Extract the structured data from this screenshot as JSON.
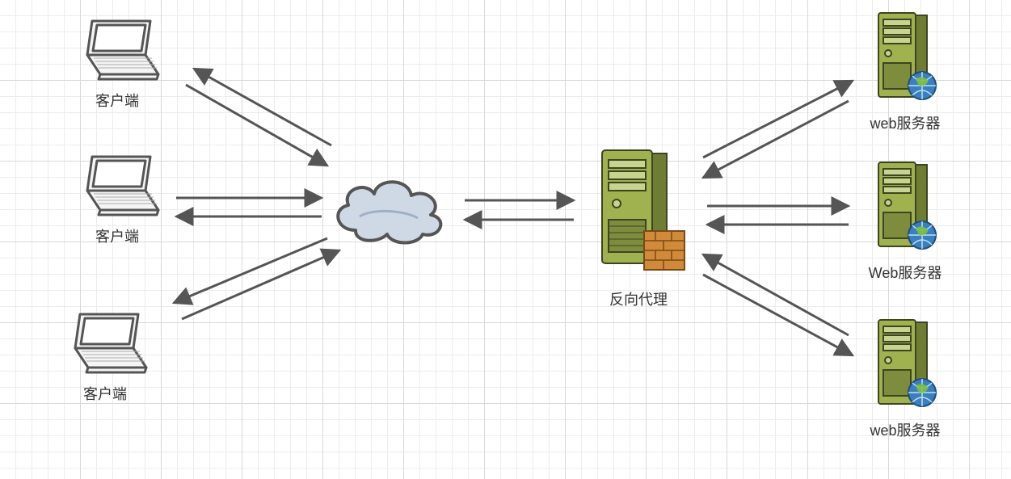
{
  "nodes": {
    "client1": {
      "label": "客户端",
      "icon": "laptop-icon"
    },
    "client2": {
      "label": "客户端",
      "icon": "laptop-icon"
    },
    "client3": {
      "label": "客户端",
      "icon": "laptop-icon"
    },
    "cloud": {
      "label": "",
      "icon": "cloud-icon"
    },
    "proxy": {
      "label": "反向代理",
      "icon": "server-firewall-icon"
    },
    "web1": {
      "label": "web服务器",
      "icon": "web-server-icon"
    },
    "web2": {
      "label": "Web服务器",
      "icon": "web-server-icon"
    },
    "web3": {
      "label": "web服务器",
      "icon": "web-server-icon"
    }
  },
  "edges": [
    {
      "from": "client1",
      "to": "cloud",
      "bidirectional": true
    },
    {
      "from": "client2",
      "to": "cloud",
      "bidirectional": true
    },
    {
      "from": "client3",
      "to": "cloud",
      "bidirectional": true
    },
    {
      "from": "cloud",
      "to": "proxy",
      "bidirectional": true
    },
    {
      "from": "proxy",
      "to": "web1",
      "bidirectional": true
    },
    {
      "from": "proxy",
      "to": "web2",
      "bidirectional": true
    },
    {
      "from": "proxy",
      "to": "web3",
      "bidirectional": true
    }
  ],
  "colors": {
    "arrow": "#555555",
    "laptopFill": "#f5f5f5",
    "laptopStroke": "#555555",
    "cloudFill": "#cfd9e6",
    "cloudStroke": "#555555",
    "serverFill": "#9fb24f",
    "serverDark": "#6f7d34",
    "serverStroke": "#3d4421",
    "firewallFill": "#d18a3a",
    "globeFill": "#3b7fbf"
  }
}
